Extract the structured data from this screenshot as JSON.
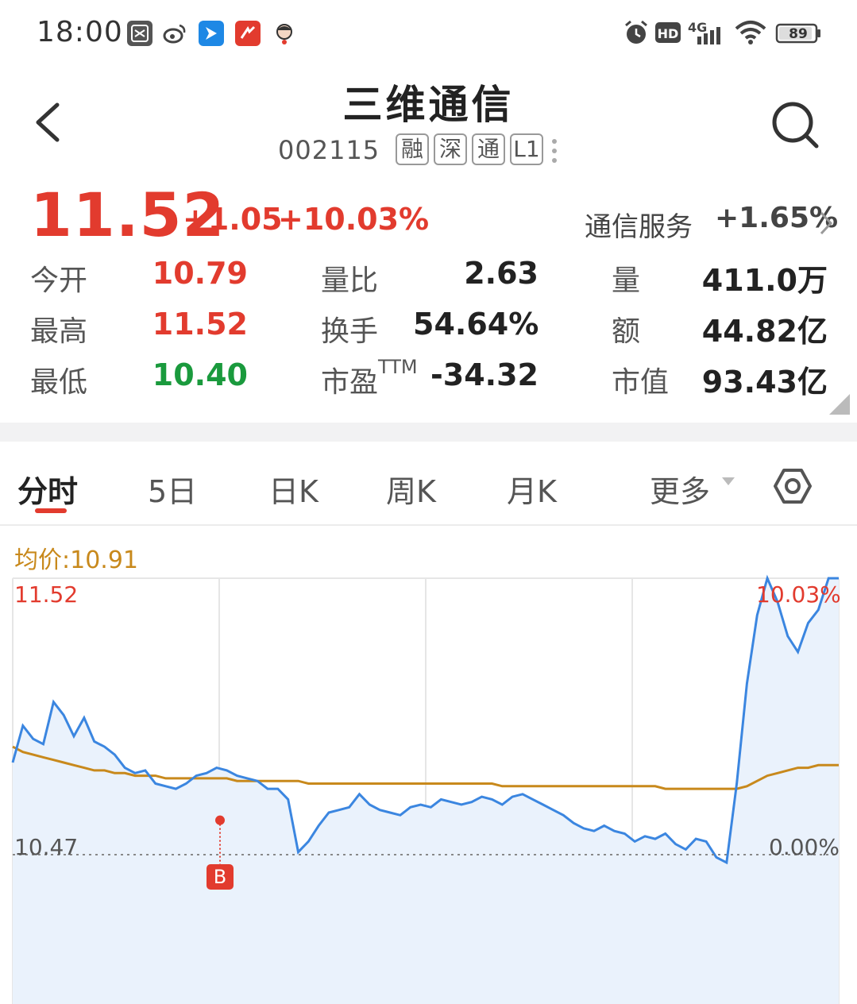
{
  "status_bar": {
    "time": "18:00",
    "battery": "89",
    "network": "4G"
  },
  "header": {
    "name": "三维通信",
    "code": "002115",
    "tags": [
      "融",
      "深",
      "通",
      "L1"
    ]
  },
  "quote": {
    "price": "11.52",
    "change": "+1.05",
    "change_pct": "+10.03%",
    "sector_name": "通信服务",
    "sector_change": "+1.65%",
    "stats": [
      {
        "label": "今开",
        "value": "10.79",
        "color": "red"
      },
      {
        "label": "量比",
        "value": "2.63",
        "color": "dark"
      },
      {
        "label": "量",
        "value": "411.0万",
        "color": "dark"
      },
      {
        "label": "最高",
        "value": "11.52",
        "color": "red"
      },
      {
        "label": "换手",
        "value": "54.64%",
        "color": "dark"
      },
      {
        "label": "额",
        "value": "44.82亿",
        "color": "dark"
      },
      {
        "label": "最低",
        "value": "10.40",
        "color": "green"
      },
      {
        "label": "市盈",
        "label_sup": "TTM",
        "value": "-34.32",
        "color": "dark"
      },
      {
        "label": "市值",
        "value": "93.43亿",
        "color": "dark"
      }
    ]
  },
  "tabs": [
    "分时",
    "5日",
    "日K",
    "周K",
    "月K",
    "更多"
  ],
  "active_tab": "分时",
  "chart": {
    "avg_label": "均价:10.91",
    "high_price": "11.52",
    "high_pct": "10.03%",
    "base_price": "10.47",
    "base_pct": "0.00%",
    "marker": "B",
    "colors": {
      "price_line": "#3b86e0",
      "avg_line": "#c8891c",
      "up": "#e23b2e",
      "down": "#1a9a3d"
    }
  },
  "chart_data": {
    "type": "line",
    "series": [
      {
        "name": "",
        "values": [
          10.82,
          10.96,
          10.91,
          10.89,
          11.05,
          11.0,
          10.92,
          10.99,
          10.9,
          10.88,
          10.85,
          10.8,
          10.78,
          10.79,
          10.74,
          10.73,
          10.72,
          10.74,
          10.77,
          10.78,
          10.8,
          10.79,
          10.77,
          10.76,
          10.75,
          10.72,
          10.72,
          10.68,
          10.48,
          10.52,
          10.58,
          10.63,
          10.64,
          10.65,
          10.7,
          10.66,
          10.64,
          10.63,
          10.62,
          10.65,
          10.66,
          10.65,
          10.68,
          10.67,
          10.66,
          10.67,
          10.69,
          10.68,
          10.66,
          10.69,
          10.7,
          10.68,
          10.66,
          10.64,
          10.62,
          10.59,
          10.57,
          10.56,
          10.58,
          10.56,
          10.55,
          10.52,
          10.54,
          10.53,
          10.55,
          10.51,
          10.49,
          10.53,
          10.52,
          10.46,
          10.44,
          10.74,
          11.12,
          11.38,
          11.52,
          11.43,
          11.3,
          11.24,
          11.35,
          11.4,
          11.52,
          11.52
        ]
      },
      {
        "name": "",
        "values": [
          10.88,
          10.86,
          10.85,
          10.84,
          10.83,
          10.82,
          10.81,
          10.8,
          10.79,
          10.79,
          10.78,
          10.78,
          10.77,
          10.77,
          10.77,
          10.76,
          10.76,
          10.76,
          10.76,
          10.76,
          10.76,
          10.76,
          10.75,
          10.75,
          10.75,
          10.75,
          10.75,
          10.75,
          10.75,
          10.74,
          10.74,
          10.74,
          10.74,
          10.74,
          10.74,
          10.74,
          10.74,
          10.74,
          10.74,
          10.74,
          10.74,
          10.74,
          10.74,
          10.74,
          10.74,
          10.74,
          10.74,
          10.74,
          10.73,
          10.73,
          10.73,
          10.73,
          10.73,
          10.73,
          10.73,
          10.73,
          10.73,
          10.73,
          10.73,
          10.73,
          10.73,
          10.73,
          10.73,
          10.73,
          10.72,
          10.72,
          10.72,
          10.72,
          10.72,
          10.72,
          10.72,
          10.72,
          10.73,
          10.75,
          10.77,
          10.78,
          10.79,
          10.8,
          10.8,
          10.81,
          10.81,
          10.81
        ]
      }
    ],
    "ylim": [
      10.4,
      11.52
    ],
    "grid": true
  }
}
